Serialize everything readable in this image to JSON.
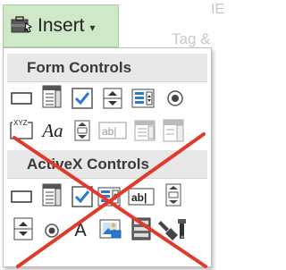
{
  "menu": {
    "button_label": "Insert",
    "chevron": "▾"
  },
  "sections": {
    "form_controls": "Form Controls",
    "activex_controls": "ActiveX Controls"
  },
  "labels": {
    "xyz": "XYZ",
    "aa": "Aa",
    "ab": "ab|",
    "a": "A"
  },
  "background_text": {
    "top": "IE",
    "tag": "Tag &"
  },
  "colors": {
    "accent_blue": "#2b78d0",
    "cross_red": "#e23a2a",
    "header_bg": "#e8e8e8",
    "button_bg": "#cfe9c8"
  },
  "icons": {
    "form_row1": [
      "button-icon",
      "combo-box-icon",
      "check-box-icon",
      "spin-button-icon",
      "list-box-icon",
      "option-button-icon"
    ],
    "form_row2": [
      "group-box-icon",
      "label-icon",
      "scroll-bar-icon",
      "text-field-icon",
      "combo-list-edit-icon",
      "combo-dropdown-edit-icon"
    ],
    "activex_row1": [
      "command-button-icon",
      "combo-box-icon",
      "check-box-icon",
      "list-box-icon",
      "text-box-icon",
      "scroll-bar-icon"
    ],
    "activex_row2": [
      "spin-button-icon",
      "option-button-icon",
      "label-icon",
      "image-icon",
      "toggle-button-icon",
      "more-controls-icon"
    ]
  }
}
